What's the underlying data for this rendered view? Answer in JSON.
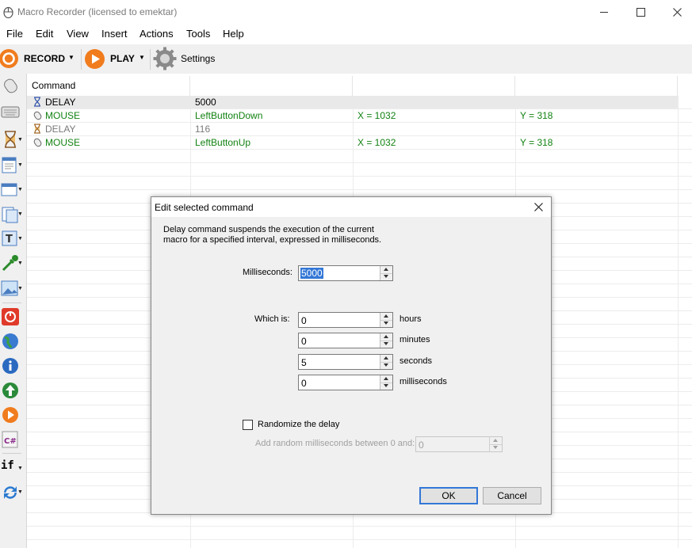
{
  "window": {
    "title": "Macro Recorder (licensed to emektar)"
  },
  "menu": [
    "File",
    "Edit",
    "View",
    "Insert",
    "Actions",
    "Tools",
    "Help"
  ],
  "toolbar": {
    "record_label": "RECORD",
    "play_label": "PLAY",
    "settings_label": "Settings"
  },
  "grid": {
    "header": "Command",
    "rows": [
      {
        "command": "DELAY",
        "c2": "5000",
        "c3": "",
        "c4": "",
        "icon": "hourglass-icon",
        "color": "#000000"
      },
      {
        "command": "MOUSE",
        "c2": "LeftButtonDown",
        "c3": "X = 1032",
        "c4": "Y = 318",
        "icon": "mouse-icon",
        "color": "#128212"
      },
      {
        "command": "DELAY",
        "c2": "116",
        "c3": "",
        "c4": "",
        "icon": "hourglass-icon",
        "color": "#7a7a7a"
      },
      {
        "command": "MOUSE",
        "c2": "LeftButtonUp",
        "c3": "X = 1032",
        "c4": "Y = 318",
        "icon": "mouse-icon",
        "color": "#128212"
      }
    ]
  },
  "dialog": {
    "title": "Edit selected command",
    "description_line1": "Delay command suspends the execution of the current",
    "description_line2": "macro for a specified interval, expressed in milliseconds.",
    "ms_label": "Milliseconds:",
    "ms_value": "5000",
    "which_is_label": "Which is:",
    "hours_value": "0",
    "hours_label": "hours",
    "minutes_value": "0",
    "minutes_label": "minutes",
    "seconds_value": "5",
    "seconds_label": "seconds",
    "milliseconds_value": "0",
    "milliseconds_label": "milliseconds",
    "randomize_label": "Randomize the delay",
    "randomize_checked": false,
    "random_label": "Add random milliseconds between 0 and:",
    "random_value": "0",
    "ok_label": "OK",
    "cancel_label": "Cancel"
  },
  "colors": {
    "accent": "#f07c1e",
    "selection": "#3377d6",
    "mouse_text": "#128212"
  }
}
